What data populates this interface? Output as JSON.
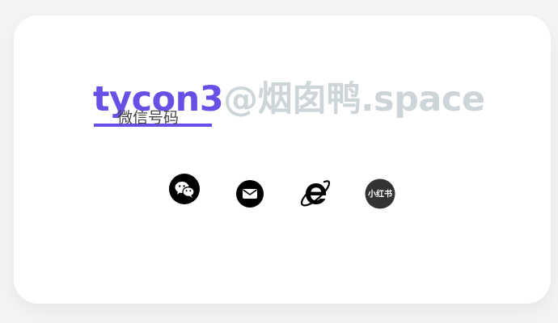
{
  "profile": {
    "handle": "tycon3",
    "domain_suffix": "@烟囱鸭.space",
    "caption": "微信号码"
  },
  "colors": {
    "accent": "#6a4fe6",
    "muted_text": "#ced5d8",
    "card_bg": "#ffffff",
    "page_bg": "#f3f4f6",
    "icon": "#000000",
    "xiaohongshu_bg": "#333333"
  },
  "social_links": [
    {
      "icon": "wechat-icon"
    },
    {
      "icon": "mail-icon"
    },
    {
      "icon": "internet-explorer-icon"
    },
    {
      "icon": "xiaohongshu-icon",
      "badge_text": "小红书"
    }
  ]
}
